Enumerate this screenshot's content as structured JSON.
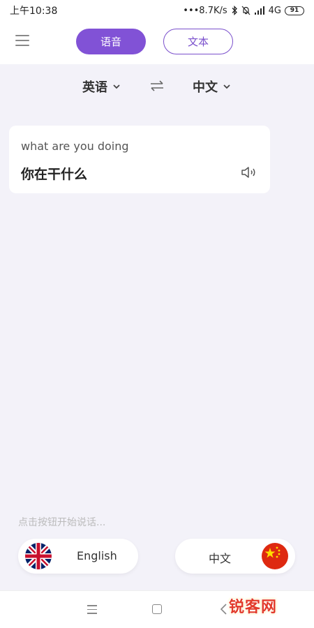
{
  "status_bar": {
    "time": "上午10:38",
    "network_speed": "•••8.7K/s",
    "network_type": "4G",
    "battery": "91"
  },
  "header": {
    "tabs": [
      {
        "label": "语音",
        "active": true
      },
      {
        "label": "文本",
        "active": false
      }
    ]
  },
  "languages": {
    "source": "英语",
    "target": "中文"
  },
  "translation_card": {
    "source_text": "what are you doing",
    "translated_text": "你在干什么"
  },
  "hint": "点击按钮开始说话...",
  "voice_buttons": [
    {
      "label": "English",
      "flag": "uk-flag-icon"
    },
    {
      "label": "中文",
      "flag": "china-flag-icon"
    }
  ],
  "watermark": "锐客网",
  "colors": {
    "accent": "#8152d6",
    "background": "#f3f2f9"
  }
}
